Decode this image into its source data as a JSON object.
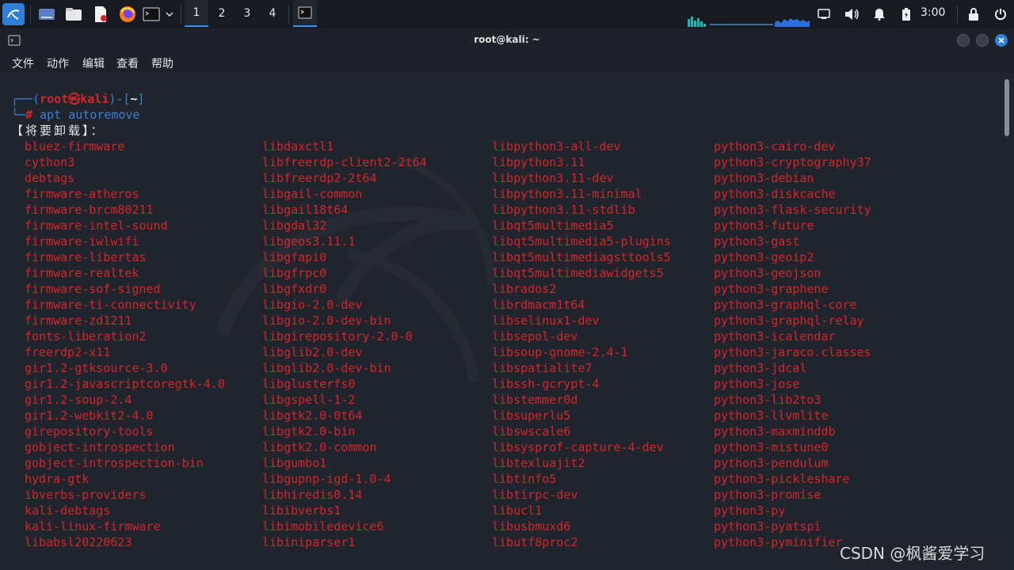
{
  "panel": {
    "workspaces": [
      "1",
      "2",
      "3",
      "4"
    ],
    "active_workspace": "1",
    "clock": "3:00"
  },
  "window": {
    "title": "root@kali: ~"
  },
  "menubar": {
    "items": [
      "文件",
      "动作",
      "编辑",
      "查看",
      "帮助"
    ]
  },
  "terminal": {
    "prompt_open": "┌──(",
    "prompt_user": "root㉿kali",
    "prompt_mid": ")-[",
    "prompt_dir": "~",
    "prompt_close": "]",
    "prompt_hash_prefix": "└─",
    "prompt_hash": "#",
    "command": "apt autoremove",
    "header": "【将要卸载】：",
    "columns": [
      [
        "bluez-firmware",
        "cython3",
        "debtags",
        "firmware-atheros",
        "firmware-brcm80211",
        "firmware-intel-sound",
        "firmware-iwlwifi",
        "firmware-libertas",
        "firmware-realtek",
        "firmware-sof-signed",
        "firmware-ti-connectivity",
        "firmware-zd1211",
        "fonts-liberation2",
        "freerdp2-x11",
        "gir1.2-gtksource-3.0",
        "gir1.2-javascriptcoregtk-4.0",
        "gir1.2-soup-2.4",
        "gir1.2-webkit2-4.0",
        "girepository-tools",
        "gobject-introspection",
        "gobject-introspection-bin",
        "hydra-gtk",
        "ibverbs-providers",
        "kali-debtags",
        "kali-linux-firmware",
        "libabsl20220623"
      ],
      [
        "libdaxctl1",
        "libfreerdp-client2-2t64",
        "libfreerdp2-2t64",
        "libgail-common",
        "libgail18t64",
        "libgdal32",
        "libgeos3.11.1",
        "libgfapi0",
        "libgfrpc0",
        "libgfxdr0",
        "libgio-2.0-dev",
        "libgio-2.0-dev-bin",
        "libgirepository-2.0-0",
        "libglib2.0-dev",
        "libglib2.0-dev-bin",
        "libglusterfs0",
        "libgspell-1-2",
        "libgtk2.0-0t64",
        "libgtk2.0-bin",
        "libgtk2.0-common",
        "libgumbo1",
        "libgupnp-igd-1.0-4",
        "libhiredis0.14",
        "libibverbs1",
        "libimobiledevice6",
        "libiniparser1"
      ],
      [
        "libpython3-all-dev",
        "libpython3.11",
        "libpython3.11-dev",
        "libpython3.11-minimal",
        "libpython3.11-stdlib",
        "libqt5multimedia5",
        "libqt5multimedia5-plugins",
        "libqt5multimediagsttools5",
        "libqt5multimediawidgets5",
        "librados2",
        "librdmacm1t64",
        "libselinux1-dev",
        "libsepol-dev",
        "libsoup-gnome-2.4-1",
        "libspatialite7",
        "libssh-gcrypt-4",
        "libstemmer0d",
        "libsuperlu5",
        "libswscale6",
        "libsysprof-capture-4-dev",
        "libtexluajit2",
        "libtinfo5",
        "libtirpc-dev",
        "libucl1",
        "libusbmuxd6",
        "libutf8proc2"
      ],
      [
        "python3-cairo-dev",
        "python3-cryptography37",
        "python3-debian",
        "python3-diskcache",
        "python3-flask-security",
        "python3-future",
        "python3-gast",
        "python3-geoip2",
        "python3-geojson",
        "python3-graphene",
        "python3-graphql-core",
        "python3-graphql-relay",
        "python3-icalendar",
        "python3-jaraco.classes",
        "python3-jdcal",
        "python3-jose",
        "python3-lib2to3",
        "python3-llvmlite",
        "python3-maxminddb",
        "python3-mistune0",
        "python3-pendulum",
        "python3-pickleshare",
        "python3-promise",
        "python3-py",
        "python3-pyatspi",
        "python3-pyminifier"
      ]
    ]
  },
  "watermark": "CSDN @枫酱爱学习",
  "colors": {
    "package_text": "#d3262b",
    "prompt_frame": "#3b82d6",
    "panel_bg": "#171a21",
    "terminal_bg": "#20242c",
    "accent": "#3d8fe0"
  },
  "icons": [
    "kali-menu-icon",
    "show-desktop-icon",
    "file-manager-icon",
    "text-editor-icon",
    "firefox-icon",
    "terminal-launcher-icon",
    "chevron-down-icon",
    "terminal-task-icon",
    "cpu-graph-icon",
    "network-graph-icon",
    "display-icon",
    "volume-icon",
    "notification-bell-icon",
    "battery-icon",
    "lock-icon",
    "power-icon",
    "terminal-window-icon",
    "minimize-icon",
    "maximize-icon",
    "close-icon"
  ]
}
